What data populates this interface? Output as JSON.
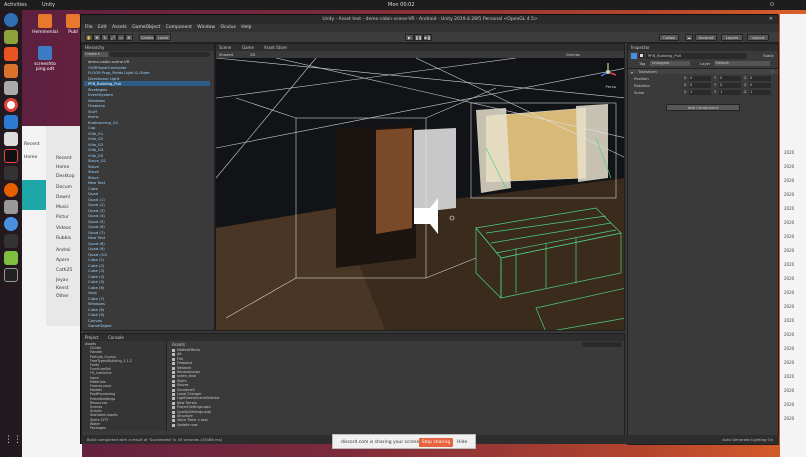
{
  "topbar": {
    "activities": "Activities",
    "app": "Unity",
    "clock": "Mon 00:02"
  },
  "desktop": {
    "icons": [
      {
        "label": "Hemmenlal"
      },
      {
        "label": "Publ"
      },
      {
        "label": "screeshto ping.odt"
      }
    ]
  },
  "files": {
    "items": [
      "Recent",
      "Home",
      "Desktop",
      "Docum",
      "Downl",
      "Music",
      "Pictur",
      "Videos",
      "Rubbis",
      "Androi",
      "Apern",
      "Cath25",
      "Jeyav",
      "Kenst",
      "Other"
    ],
    "header_left": "Recent",
    "header_right": "Home"
  },
  "unity": {
    "title": "Unity - Asset test - demo-cabin-scene-VR - Android - Unity 2019.4.26f1 Personal <OpenGL 4.5>",
    "menu": [
      "File",
      "Edit",
      "Assets",
      "GameObject",
      "Component",
      "Window",
      "Oculus",
      "Help"
    ],
    "toolbar": {
      "center": "Center",
      "local": "Local",
      "collab": "Collab",
      "account": "Account",
      "layers": "Layers",
      "layout": "Layout"
    },
    "hierarchy": {
      "tab": "Hierarchy",
      "rows": [
        "demo-cabin-scene-VR",
        "OVRPlayerController",
        "FLOOR Prop_Fields Light & Other",
        "Directional Light",
        "PFB_Building_Pull",
        "Strategies",
        "EventSystem",
        "Windows",
        "Fireplace",
        "Stuff",
        "Items",
        "Knobunlring_G1",
        "Cup",
        "Villa_G1",
        "Villa_G2",
        "Villa_G3",
        "Villa_G4",
        "Villa_G5",
        "Stove_G1",
        "Stove",
        "Stove",
        "Stove",
        "New Text",
        "Cube",
        "Quad",
        "Quad (1)",
        "Quad (2)",
        "Quad (3)",
        "Quad (4)",
        "Quad (5)",
        "Quad (6)",
        "Quad (7)",
        "New Text",
        "Quad (8)",
        "Quad (9)",
        "Quad (10)",
        "Cube (1)",
        "Cube (2)",
        "Cube (3)",
        "Cube (4)",
        "Cube (5)",
        "Cube (6)",
        "Vase",
        "Cube (7)",
        "Windows",
        "Cube (8)",
        "Cube (9)",
        "Canvas",
        "GameObject"
      ],
      "selected_index": 4
    },
    "scene": {
      "tabs": [
        "Scene",
        "Game",
        "Asset Store"
      ],
      "shading": "Shaded",
      "dim": "2D",
      "gizmos": "Gizmos",
      "persp": "Persp"
    },
    "inspector": {
      "tab": "Inspector",
      "object": "PFB_Building_Pull",
      "static": "Static",
      "tag_label": "Tag",
      "tag_value": "Untagged",
      "layer_label": "Layer",
      "layer_value": "Default",
      "transform": "Transform",
      "fields": [
        {
          "label": "Position",
          "x": "0",
          "y": "0",
          "z": "0"
        },
        {
          "label": "Rotation",
          "x": "0",
          "y": "0",
          "z": "0"
        },
        {
          "label": "Scale",
          "x": "1",
          "y": "1",
          "z": "1"
        }
      ],
      "add_component": "Add Component"
    },
    "project": {
      "tabs": [
        "Project",
        "Console"
      ],
      "breadcrumb": "Assets",
      "tree": [
        "Assets",
        "Clutter",
        "Handle",
        "Prelude_Oculus",
        "FreeTypes/Building_1.1.2",
        "Fonts",
        "FurnitureSet",
        "FX_Laminina",
        "Input",
        "Materials",
        "Frames pack",
        "Models",
        "PostProcessing",
        "ProbeBuildings",
        "Resources",
        "Scenes",
        "Scripts",
        "Standard Assets",
        "Stairs CITY",
        "Water",
        "Packages"
      ],
      "files": [
        "MattesEffects",
        "Ait",
        "Fire",
        "Fireplace",
        "Network",
        "Rousbassings",
        "sceen_thse",
        "Stairs",
        "Stoves",
        "Sondsmell",
        "Lanal Changer",
        "LightGameSceneSelector",
        "New Terrain",
        "ProjectSettings.aspl",
        "QualitySettings.aspl",
        "Structure",
        "Voice Timer z aspl",
        "Update new"
      ]
    },
    "status": "Build completed with a result of 'Succeeded' in 43 seconds (43486 ms)",
    "status_right": "Auto Generate Lighting On"
  },
  "share": {
    "text": "discord.com is sharing your screen.",
    "stop": "Stop sharing",
    "hide": "Hide"
  },
  "right_numbers": [
    "2020",
    "2020",
    "2020",
    "2020",
    "2020",
    "2020",
    "2020",
    "2020",
    "2020",
    "2020",
    "2020",
    "2020",
    "2020",
    "2020",
    "2020",
    "2020",
    "2020",
    "2020",
    "2020",
    "2020"
  ]
}
